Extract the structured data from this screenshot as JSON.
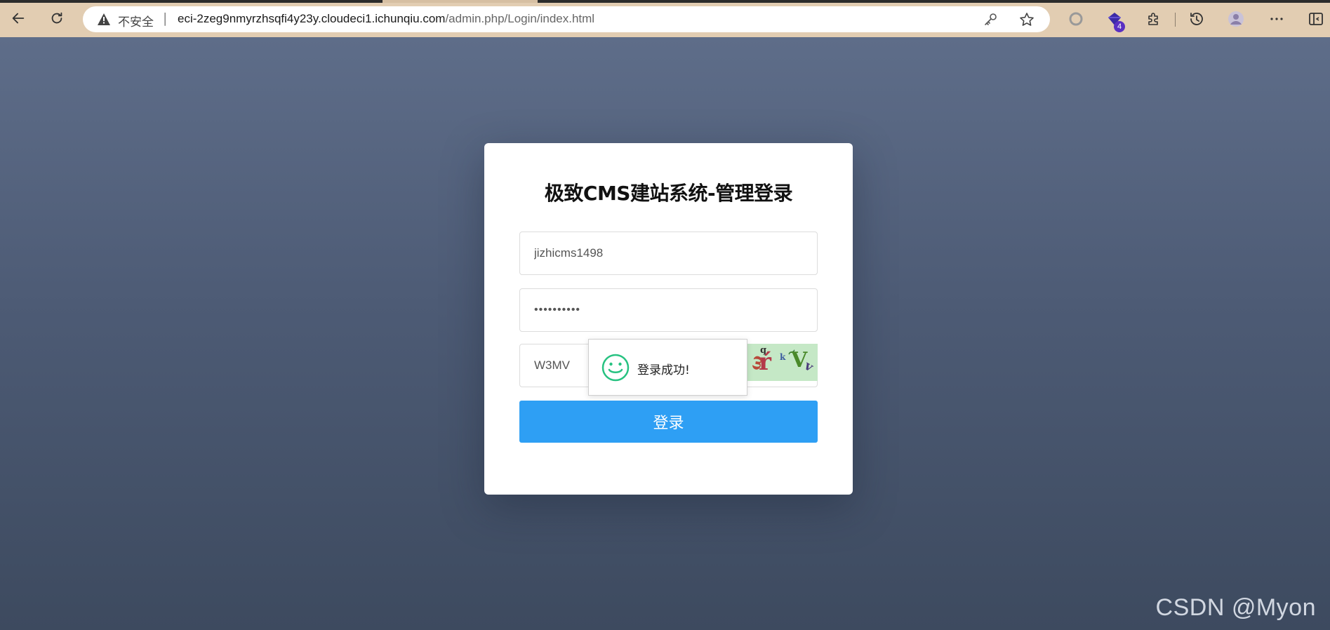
{
  "browser": {
    "security_label": "不安全",
    "url_host": "eci-2zeg9nmyrzhsqfi4y23y.cloudeci1.ichunqiu.com",
    "url_path": "/admin.php/Login/index.html",
    "extension_badge": "4"
  },
  "login": {
    "title": "极致CMS建站系统-管理登录",
    "username_value": "jizhicms1498",
    "password_value": "••••••••••",
    "captcha_value": "W3MV",
    "submit_label": "登录"
  },
  "toast": {
    "message": "登录成功!",
    "icon": "smiley-icon"
  },
  "watermark": "CSDN @Myon",
  "colors": {
    "primary_button": "#2e9ff4",
    "toast_icon": "#27c281",
    "page_background": "#4f5d77",
    "chrome_background": "#e2cdb2"
  }
}
